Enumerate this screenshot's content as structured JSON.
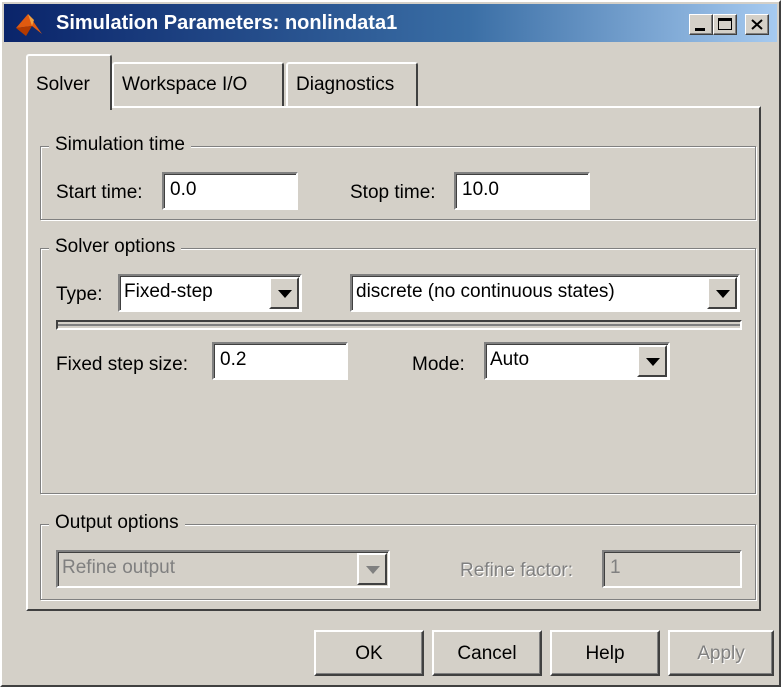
{
  "window": {
    "title": "Simulation Parameters: nonlindata1",
    "icon": "matlab-icon"
  },
  "tabs": [
    {
      "label": "Solver",
      "active": true
    },
    {
      "label": "Workspace I/O",
      "active": false
    },
    {
      "label": "Diagnostics",
      "active": false
    }
  ],
  "simulation_time": {
    "title": "Simulation time",
    "start_label": "Start time:",
    "start_value": "0.0",
    "stop_label": "Stop time:",
    "stop_value": "10.0"
  },
  "solver_options": {
    "title": "Solver options",
    "type_label": "Type:",
    "type_value": "Fixed-step",
    "solver_value": "discrete (no continuous states)",
    "step_label": "Fixed step size:",
    "step_value": "0.2",
    "mode_label": "Mode:",
    "mode_value": "Auto"
  },
  "output_options": {
    "title": "Output options",
    "refine_output": "Refine output",
    "refine_factor_label": "Refine factor:",
    "refine_factor_value": "1"
  },
  "buttons": {
    "ok": "OK",
    "cancel": "Cancel",
    "help": "Help",
    "apply": "Apply"
  }
}
